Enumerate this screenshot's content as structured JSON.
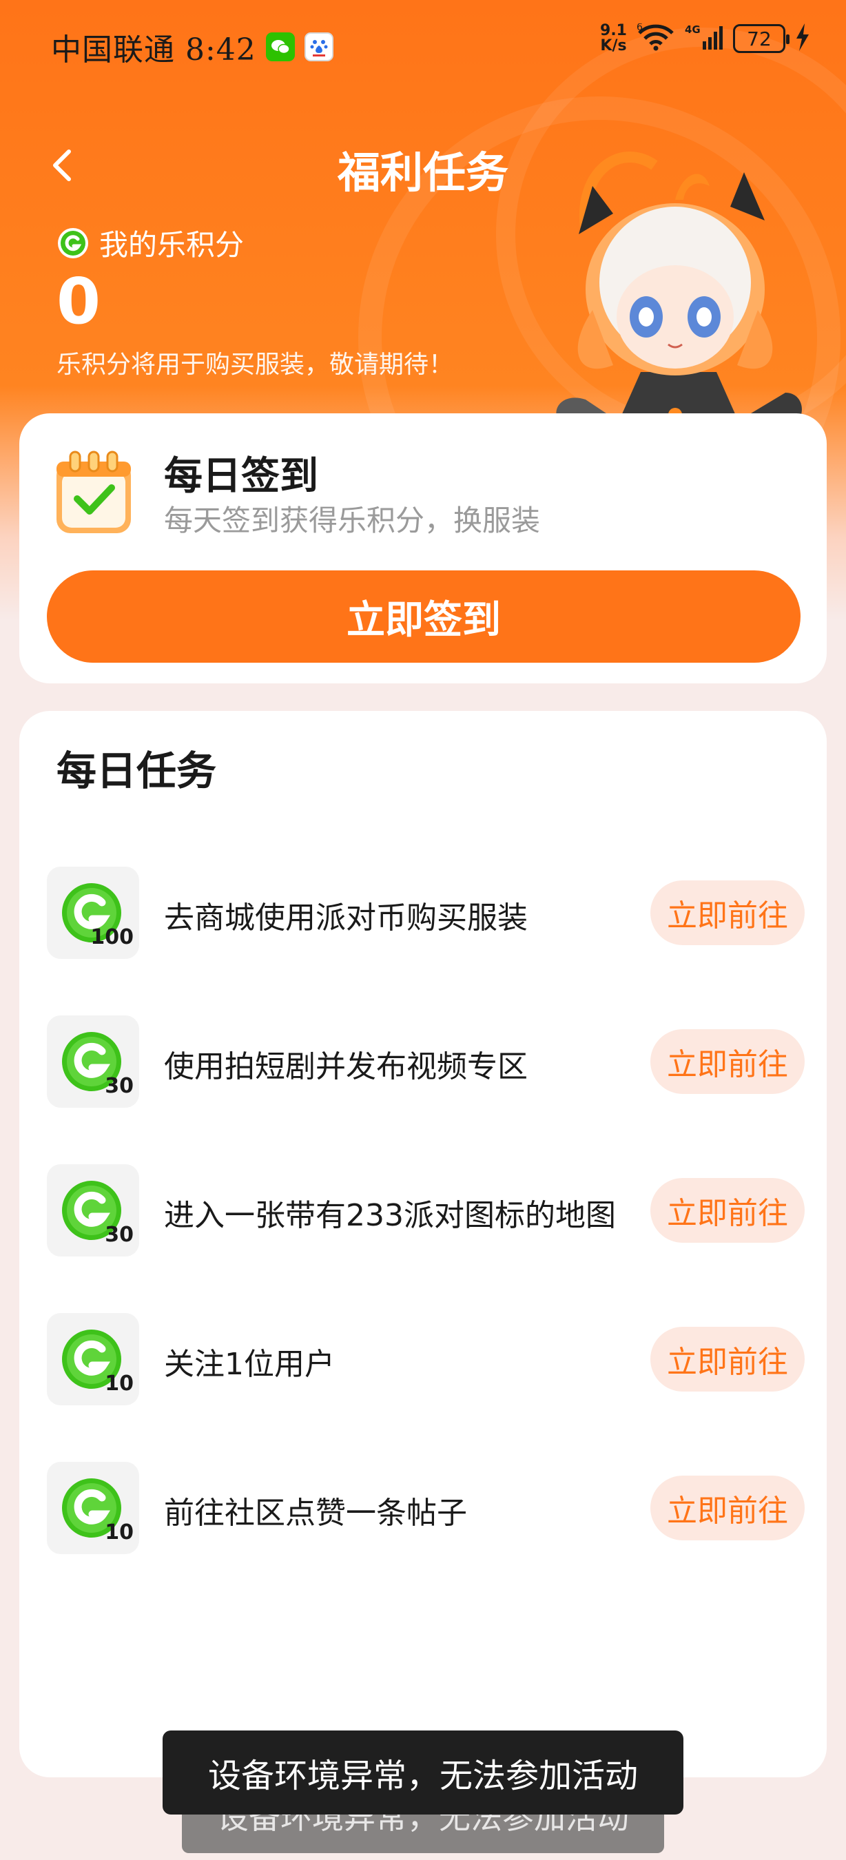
{
  "status_bar": {
    "carrier_time": "中国联通 8:42",
    "net_speed_value": "9.1",
    "net_speed_unit": "K/s",
    "battery": "72"
  },
  "header": {
    "title": "福利任务",
    "points_label": "我的乐积分",
    "points_value": "0",
    "points_note": "乐积分将用于购买服装，敬请期待！"
  },
  "checkin": {
    "title": "每日签到",
    "subtitle": "每天签到获得乐积分，换服装",
    "button": "立即签到"
  },
  "daily_tasks": {
    "title": "每日任务",
    "items": [
      {
        "reward": "100",
        "text": "去商城使用派对币购买服装",
        "button": "立即前往"
      },
      {
        "reward": "30",
        "text": "使用拍短剧并发布视频专区",
        "button": "立即前往"
      },
      {
        "reward": "30",
        "text": "进入一张带有233派对图标的地图",
        "button": "立即前往"
      },
      {
        "reward": "10",
        "text": "关注1位用户",
        "button": "立即前往"
      },
      {
        "reward": "10",
        "text": "前往社区点赞一条帖子",
        "button": "立即前往"
      }
    ]
  },
  "toasts": {
    "front": "设备环境异常，无法参加活动",
    "back": "设备环境异常，无法参加活动"
  },
  "colors": {
    "accent": "#ff7418",
    "coin_green": "#3ec21a",
    "go_button_bg": "#fde8e0"
  },
  "icons": [
    "wechat-icon",
    "baidu-icon",
    "wifi-icon",
    "signal-icon",
    "battery-icon",
    "charging-icon",
    "back-icon",
    "points-coin-icon",
    "calendar-check-icon",
    "reward-coin-icon"
  ]
}
